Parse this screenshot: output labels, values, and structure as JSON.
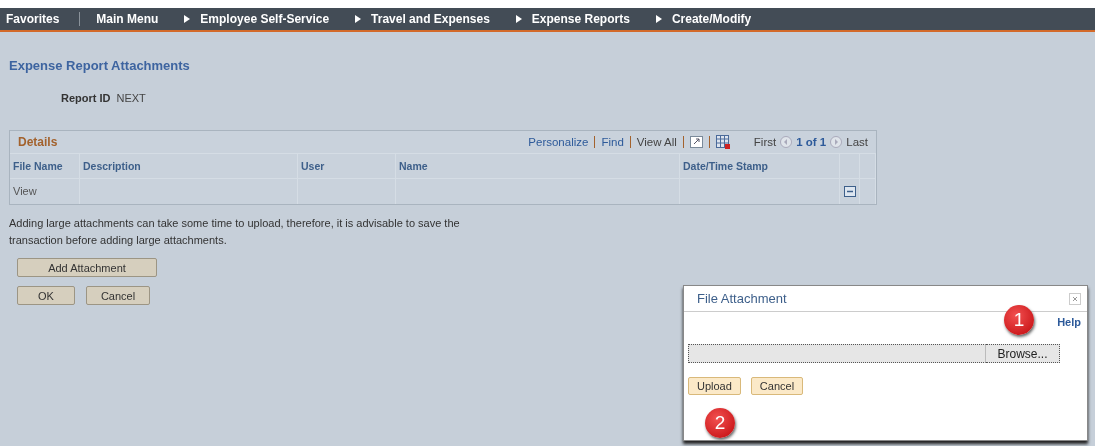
{
  "nav": [
    {
      "label": "Favorites",
      "kind": "menu"
    },
    {
      "label": "Main Menu",
      "kind": "menu"
    },
    {
      "label": "Employee Self-Service",
      "kind": "crumb"
    },
    {
      "label": "Travel and Expenses",
      "kind": "crumb"
    },
    {
      "label": "Expense Reports",
      "kind": "crumb"
    },
    {
      "label": "Create/Modify",
      "kind": "crumb"
    }
  ],
  "page_title": "Expense Report Attachments",
  "report_id": {
    "label": "Report ID",
    "value": "NEXT"
  },
  "details": {
    "title": "Details",
    "links": [
      "Personalize",
      "Find"
    ],
    "view_all": "View All",
    "pager": {
      "first": "First",
      "count": "1 of 1",
      "last": "Last"
    },
    "columns": [
      "File Name",
      "Description",
      "User",
      "Name",
      "Date/Time Stamp"
    ],
    "rows": [
      [
        "View",
        "",
        "",
        "",
        ""
      ]
    ]
  },
  "note": "Adding large attachments can take some time to upload, therefore, it is advisable to save the transaction before adding large attachments.",
  "add_button": "Add Attachment",
  "buttons": [
    "OK",
    "Cancel"
  ],
  "dialog": {
    "title": "File Attachment",
    "help": "Help",
    "browse": "Browse...",
    "buttons": [
      "Upload",
      "Cancel"
    ],
    "markers": [
      "1",
      "2"
    ]
  }
}
